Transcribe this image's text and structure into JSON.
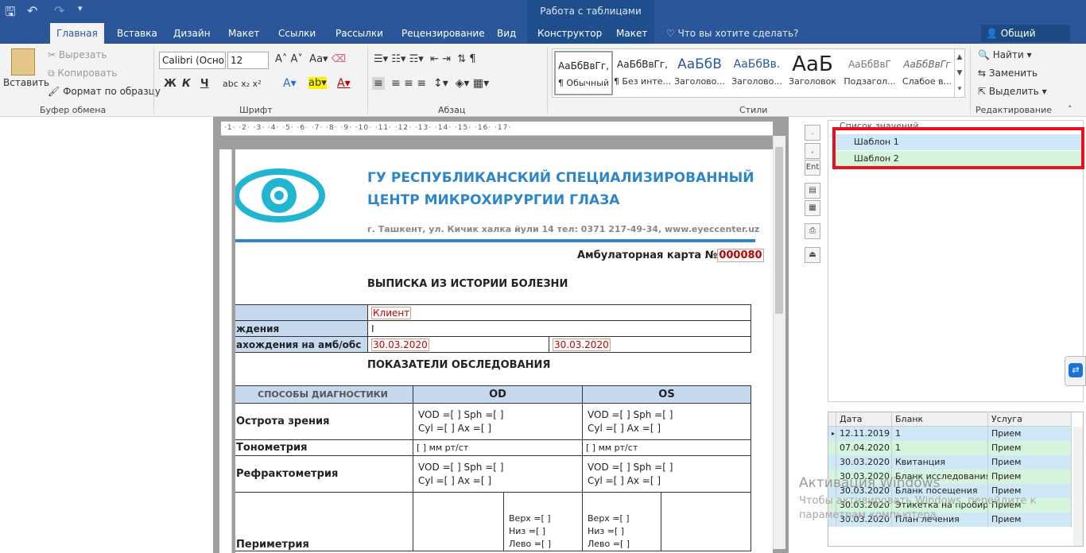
{
  "titlebar": {
    "context_title": "Работа с таблицами"
  },
  "tabs": [
    "Главная",
    "Вставка",
    "Дизайн",
    "Макет",
    "Ссылки",
    "Рассылки",
    "Рецензирование",
    "Вид",
    "Конструктор",
    "Макет"
  ],
  "search_hint": "Что вы хотите сделать?",
  "share_label": "Общий доступ",
  "clipboard": {
    "paste": "Вставить",
    "cut": "Вырезать",
    "copy": "Копировать",
    "format": "Формат по образцу",
    "group": "Буфер обмена"
  },
  "font": {
    "name": "Calibri (Осно",
    "size": "12",
    "group": "Шрифт",
    "bold": "Ж",
    "italic": "К",
    "underline": "Ч"
  },
  "paragraph": {
    "group": "Абзац"
  },
  "styles": {
    "group": "Стили",
    "items": [
      {
        "preview": "АаБбВвГг,",
        "name": "¶ Обычный"
      },
      {
        "preview": "АаБбВвГг,",
        "name": "¶ Без инте..."
      },
      {
        "preview": "АаБбВ",
        "name": "Заголово..."
      },
      {
        "preview": "АаБбВв.",
        "name": "Заголово..."
      },
      {
        "preview": "АаБ",
        "name": "Заголовок"
      },
      {
        "preview": "АаБбВвГ",
        "name": "Подзагол..."
      },
      {
        "preview": "АаБбВвГг",
        "name": "Слабое в..."
      }
    ]
  },
  "editing": {
    "find": "Найти",
    "replace": "Заменить",
    "select": "Выделить",
    "group": "Редактирование"
  },
  "doc": {
    "org_line1": "ГУ  РЕСПУБЛИКАНСКИЙ СПЕЦИАЛИЗИРОВАННЫЙ",
    "org_line2": "ЦЕНТР МИКРОХИРУРГИИ ГЛАЗА",
    "address": "г. Ташкент, ул. Кичик халка йули 14  тел: 0371 217-49-34, www.eyeccenter.uz",
    "card_label": "Амбулаторная карта №",
    "card_no": "000080",
    "heading1": "ВЫПИСКА ИЗ ИСТОРИИ БОЛЕЗНИ",
    "client": "Клиент",
    "row_birth": "ждения",
    "row_stay": "ахождения на амб/обс",
    "date1": "30.03.2020",
    "date2": "30.03.2020",
    "heading2": "ПОКАЗАТЕЛИ ОБСЛЕДОВАНИЯ",
    "col_methods": "СПОСОБЫ ДИАГНОСТИКИ",
    "col_od": "OD",
    "col_os": "OS",
    "r_acuity": "Острота зрения",
    "r_tono": "Тонометрия",
    "r_refr": "Рефрактометрия",
    "r_perim": "Периметрия",
    "vod": "VOD =[  ] Sph =[ ]",
    "cyl": "Cyl =[ ] Ax =[ ]",
    "mmhg": "[ ] мм рт/ст",
    "up": "Верх =[ ]",
    "down": "Низ =[ ]",
    "left": "Лево =[ ]"
  },
  "side_buttons": [
    ".",
    ",",
    "Ent"
  ],
  "tree": {
    "header": "Список значений",
    "items": [
      "Шаблон 1",
      "Шаблон 2"
    ]
  },
  "grid": {
    "columns": [
      "Дата",
      "Бланк",
      "Услуга"
    ],
    "rows": [
      [
        "12.11.2019",
        "1",
        "Прием"
      ],
      [
        "07.04.2020",
        "1",
        "Прием"
      ],
      [
        "30.03.2020",
        "Квитанция",
        "Прием"
      ],
      [
        "30.03.2020",
        "Бланк исследования",
        "Прием"
      ],
      [
        "30.03.2020",
        "Бланк посещения",
        "Прием"
      ],
      [
        "30.03.2020",
        "Этикетка на пробирку",
        "Прием"
      ],
      [
        "30.03.2020",
        "План лечения",
        "Прием"
      ]
    ]
  },
  "watermark": {
    "title": "Активация Windows",
    "text": "Чтобы активировать Windows, перейдите к параметрам компьютера."
  },
  "colors": {
    "brand": "#2b579a",
    "accent_red": "#e8111d",
    "row_blue": "#cfe8f7",
    "row_green": "#d4f5dc"
  }
}
